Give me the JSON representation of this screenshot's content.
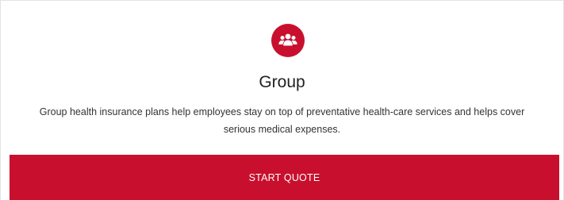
{
  "card": {
    "icon": "group-people-icon",
    "title": "Group",
    "description": "Group health insurance plans help employees stay on top of preventative health-care services and helps cover serious medical expenses.",
    "cta_label": "START QUOTE"
  },
  "colors": {
    "accent": "#c8102e",
    "background": "#ffffff",
    "text": "#333333"
  }
}
